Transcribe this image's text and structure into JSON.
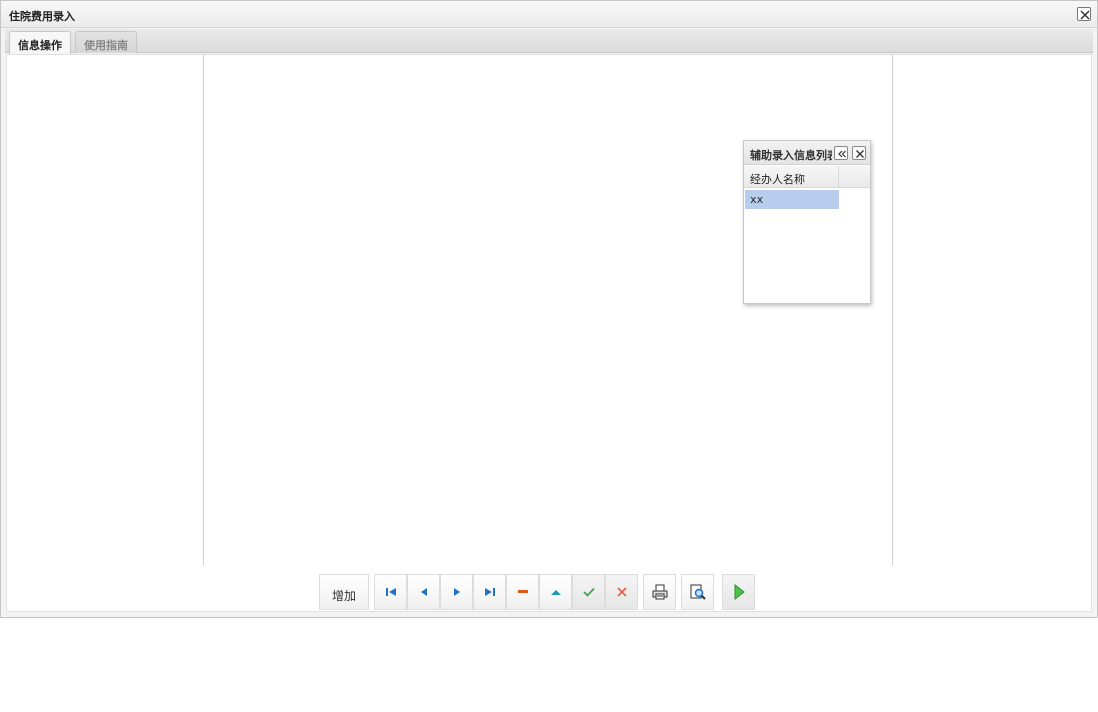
{
  "window": {
    "title": "住院费用录入"
  },
  "tabs": [
    {
      "label": "信息操作",
      "active": true
    },
    {
      "label": "使用指南",
      "active": false
    }
  ],
  "toolbar": {
    "add_label": "增加",
    "icons": [
      "first-icon",
      "prev-icon",
      "next-icon",
      "last-icon",
      "delete-icon",
      "up-icon",
      "confirm-icon",
      "cancel-icon",
      "print-icon",
      "print-preview-icon",
      "run-icon"
    ]
  },
  "popup": {
    "title": "辅助录入信息列表",
    "column_header": "经办人名称",
    "rows": [
      "xx"
    ]
  },
  "colors": {
    "nav_blue": "#1e73c8",
    "delete_orange": "#e0571a",
    "confirm_green": "#3fa34d",
    "cancel_red": "#e06040",
    "run_green": "#4cc24c",
    "selected_row": "#b7cdee"
  }
}
